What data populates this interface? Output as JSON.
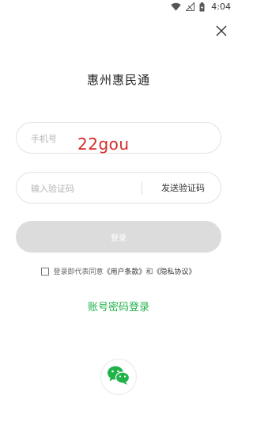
{
  "status_bar": {
    "time": "4:04",
    "icons": [
      "wifi-icon",
      "signal-icon",
      "battery-icon"
    ]
  },
  "header": {
    "close_icon": "close-icon",
    "title": "惠州惠民通"
  },
  "form": {
    "phone_placeholder": "手机号",
    "code_placeholder": "输入验证码",
    "send_code_label": "发送验证码",
    "login_label": "登录"
  },
  "watermark": "22gou",
  "agreement": {
    "prefix": "登录即代表同意",
    "terms": "《用户条款》",
    "and": "和",
    "privacy": "《隐私协议》"
  },
  "account_login_label": "账号密码登录",
  "social": {
    "wechat_icon": "wechat-icon"
  },
  "colors": {
    "accent": "#21b24a",
    "button_disabled": "#dcdcdc",
    "watermark": "#d52b2b"
  }
}
